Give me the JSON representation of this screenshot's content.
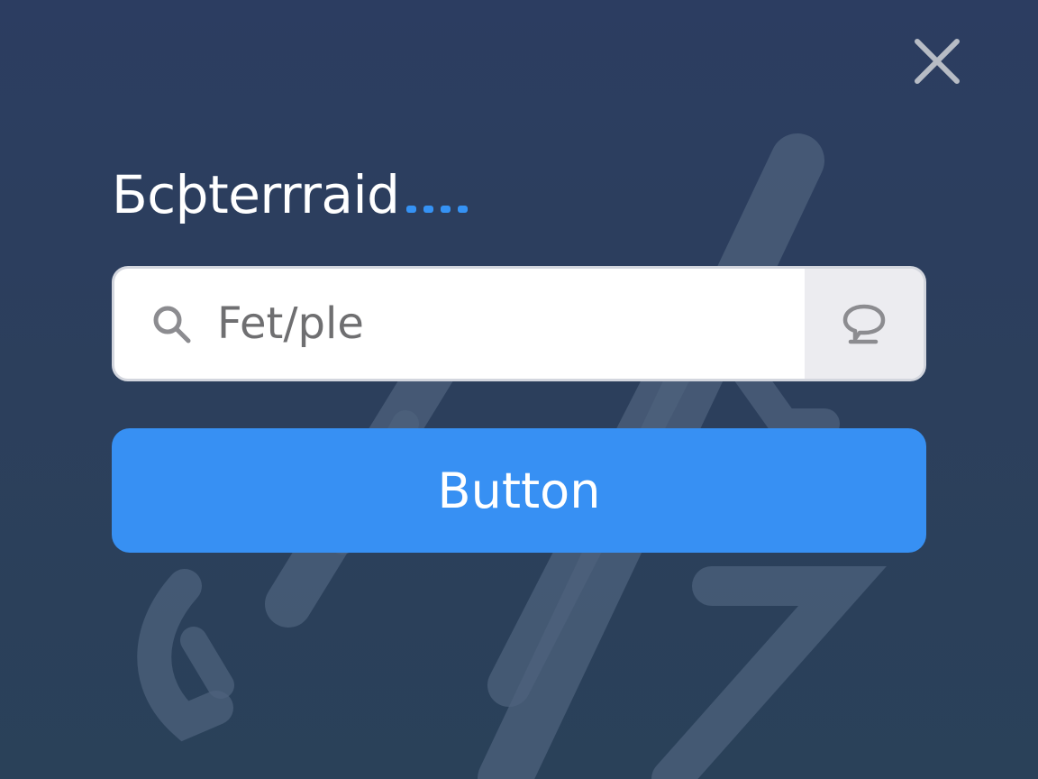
{
  "dialog": {
    "title": "Бcþterrraid",
    "close_icon": "close-icon"
  },
  "search": {
    "value": "Fet/ple",
    "search_icon": "search-icon",
    "addon_icon": "chat-bubble-icon"
  },
  "primary_button": {
    "label": "Button"
  },
  "colors": {
    "background": "#2c3e5e",
    "accent": "#3790f3",
    "input_background": "#ffffff",
    "addon_background": "#ececf0",
    "icon_gray": "#8c8c90"
  }
}
